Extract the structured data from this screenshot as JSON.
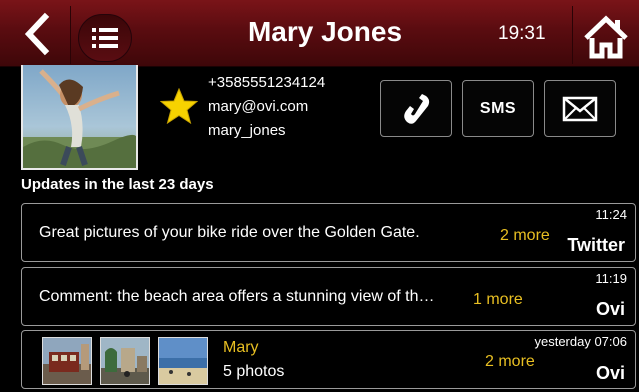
{
  "header": {
    "title": "Mary Jones",
    "time": "19:31",
    "accent": "#6a1014"
  },
  "contact": {
    "phone": "+3585551234124",
    "email": "mary@ovi.com",
    "username": "mary_jones",
    "favorite": true,
    "actions": {
      "call_icon": "phone-icon",
      "sms_label": "SMS",
      "email_icon": "envelope-icon"
    }
  },
  "updates": {
    "heading": "Updates in the last 23 days",
    "items": [
      {
        "text": "Great pictures of your bike ride over the Golden Gate.",
        "more": "2 more",
        "time": "11:24",
        "source": "Twitter"
      },
      {
        "text": "Comment: the beach area offers a stunning view of th…",
        "more": "1 more",
        "time": "11:19",
        "source": "Ovi"
      },
      {
        "author": "Mary",
        "subtitle": "5 photos",
        "more": "2 more",
        "time": "yesterday 07:06",
        "source": "Ovi"
      }
    ]
  }
}
